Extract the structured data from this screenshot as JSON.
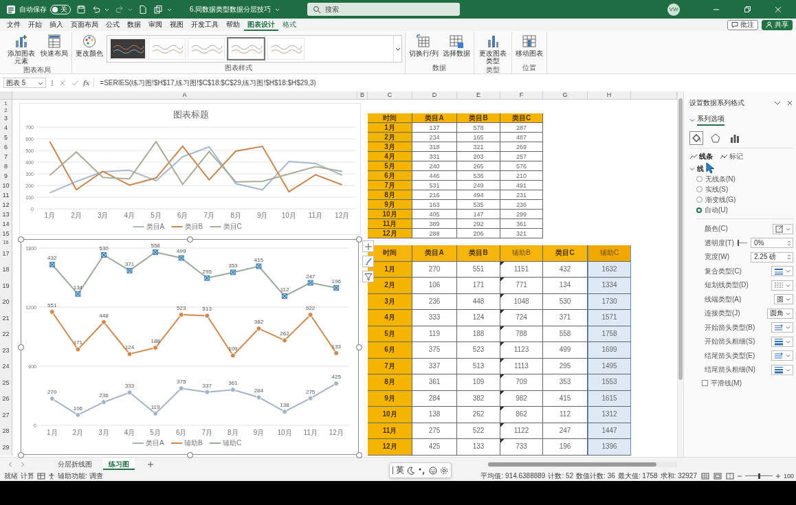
{
  "title_bar": {
    "autosave": {
      "label": "自动保存",
      "on": false,
      "state": "关"
    },
    "filename": "6.同数据类型数据分层技巧",
    "search": {
      "placeholder": "搜索"
    },
    "avatar": "VW"
  },
  "ribbon_tabs": [
    {
      "label": "文件",
      "selected": false,
      "contextual": false
    },
    {
      "label": "开始",
      "selected": false,
      "contextual": false
    },
    {
      "label": "插入",
      "selected": false,
      "contextual": false
    },
    {
      "label": "页面布局",
      "selected": false,
      "contextual": false
    },
    {
      "label": "公式",
      "selected": false,
      "contextual": false
    },
    {
      "label": "数据",
      "selected": false,
      "contextual": false
    },
    {
      "label": "审阅",
      "selected": false,
      "contextual": false
    },
    {
      "label": "视图",
      "selected": false,
      "contextual": false
    },
    {
      "label": "开发工具",
      "selected": false,
      "contextual": false
    },
    {
      "label": "帮助",
      "selected": false,
      "contextual": false
    },
    {
      "label": "图表设计",
      "selected": true,
      "contextual": true
    },
    {
      "label": "格式",
      "selected": false,
      "contextual": true
    }
  ],
  "ribbon_actions": [
    {
      "label": "批注",
      "kind": "comments"
    },
    {
      "label": "共享",
      "kind": "share"
    }
  ],
  "ribbon_groups": [
    {
      "name": "图表布局",
      "buttons": [
        {
          "label": "添加图表元素",
          "kind": "add_element"
        },
        {
          "label": "快速布局",
          "kind": "quick_layout"
        }
      ]
    },
    {
      "name": "图表样式",
      "buttons": [
        {
          "label": "更改颜色",
          "kind": "palette"
        }
      ],
      "gallery": [
        {
          "dark": true,
          "selected": false
        },
        {
          "dark": false,
          "selected": false
        },
        {
          "dark": false,
          "selected": false
        },
        {
          "dark": false,
          "selected": true
        },
        {
          "dark": false,
          "selected": false
        }
      ]
    },
    {
      "name": "数据",
      "buttons": [
        {
          "label": "切换行/列",
          "kind": "switch"
        },
        {
          "label": "选择数据",
          "kind": "select_data"
        }
      ]
    },
    {
      "name": "类型",
      "buttons": [
        {
          "label": "更改图表类型",
          "kind": "chart_type"
        }
      ]
    },
    {
      "name": "位置",
      "buttons": [
        {
          "label": "移动图表",
          "kind": "move"
        }
      ]
    }
  ],
  "formula_bar": {
    "name_box": "图表 5",
    "function_label": "fx",
    "formula": "=SERIES(练习图!$H$17,练习图!$C$18:$C$29,练习图!$H$18:$H$29,3)"
  },
  "sheet": {
    "columns": [
      "A",
      "B",
      "C",
      "D",
      "E",
      "F",
      "G",
      "H"
    ],
    "rows": [
      "1",
      "2",
      "3",
      "4",
      "5",
      "6",
      "7",
      "8",
      "9",
      "10",
      "11",
      "12",
      "13",
      "14",
      "15",
      "16",
      "17",
      "18",
      "19",
      "20",
      "21",
      "22",
      "23",
      "24",
      "25",
      "26",
      "27",
      "28",
      "29"
    ]
  },
  "charts": [
    {
      "title": "图表标题",
      "selected": false,
      "chart_data": {
        "type": "line",
        "categories": [
          "1月",
          "2月",
          "3月",
          "4月",
          "5月",
          "6月",
          "7月",
          "8月",
          "9月",
          "10月",
          "11月",
          "12月"
        ],
        "ylim": [
          0,
          700
        ],
        "yticks": [
          0,
          100,
          200,
          300,
          400,
          500,
          600,
          700
        ],
        "grid": true,
        "legend": "bottom",
        "series": [
          {
            "name": "类目A",
            "color": "#a7b8cf",
            "values": [
              137,
              234,
              318,
              331,
              240,
              446,
              531,
              216,
              163,
              405,
              389,
              288
            ]
          },
          {
            "name": "类目B",
            "color": "#c9864f",
            "values": [
              578,
              165,
              321,
              203,
              265,
              536,
              249,
              494,
              535,
              147,
              292,
              206
            ]
          },
          {
            "name": "类目C",
            "color": "#a8ad98",
            "values": [
              287,
              487,
              269,
              257,
              576,
              210,
              491,
              231,
              236,
              299,
              361,
              321
            ]
          }
        ]
      }
    },
    {
      "selected": true,
      "chart_data": {
        "type": "line",
        "categories": [
          "1月",
          "2月",
          "3月",
          "4月",
          "5月",
          "6月",
          "7月",
          "8月",
          "9月",
          "10月",
          "11月",
          "12月"
        ],
        "ylim": [
          0,
          1800
        ],
        "yticks": [
          0,
          600,
          1200,
          1800
        ],
        "grid": true,
        "legend": "bottom",
        "series": [
          {
            "name": "类目A",
            "color": "#a3b4c6",
            "marker": "circle",
            "values": [
              270,
              106,
              236,
              333,
              119,
              375,
              337,
              361,
              284,
              138,
              275,
              425
            ]
          },
          {
            "name": "辅助B",
            "color": "#d0884c",
            "marker": "circle",
            "values": [
              1151,
              771,
              1048,
              724,
              788,
              1123,
              1113,
              709,
              982,
              862,
              1122,
              733
            ]
          },
          {
            "name": "辅助C",
            "color": "#9aa99a",
            "marker": "square",
            "values": [
              1632,
              1334,
              1730,
              1571,
              1758,
              1699,
              1495,
              1553,
              1615,
              1312,
              1447,
              1396
            ]
          }
        ],
        "annotations": [
          {
            "x": "1月",
            "y": 270,
            "text": "270"
          },
          {
            "x": "2月",
            "y": 106,
            "text": "106"
          },
          {
            "x": "3月",
            "y": 236,
            "text": "236"
          },
          {
            "x": "4月",
            "y": 333,
            "text": "333"
          },
          {
            "x": "5月",
            "y": 119,
            "text": "119"
          },
          {
            "x": "6月",
            "y": 375,
            "text": "375"
          },
          {
            "x": "7月",
            "y": 337,
            "text": "337"
          },
          {
            "x": "8月",
            "y": 361,
            "text": "361"
          },
          {
            "x": "9月",
            "y": 284,
            "text": "284"
          },
          {
            "x": "10月",
            "y": 138,
            "text": "138"
          },
          {
            "x": "11月",
            "y": 275,
            "text": "275"
          },
          {
            "x": "12月",
            "y": 425,
            "text": "425"
          },
          {
            "x": "1月",
            "y": 1151,
            "text": "551"
          },
          {
            "x": "2月",
            "y": 771,
            "text": "171"
          },
          {
            "x": "3月",
            "y": 1048,
            "text": "448"
          },
          {
            "x": "4月",
            "y": 724,
            "text": "124"
          },
          {
            "x": "5月",
            "y": 788,
            "text": "188"
          },
          {
            "x": "6月",
            "y": 1123,
            "text": "523"
          },
          {
            "x": "7月",
            "y": 1113,
            "text": "513"
          },
          {
            "x": "8月",
            "y": 709,
            "text": "109"
          },
          {
            "x": "9月",
            "y": 982,
            "text": "382"
          },
          {
            "x": "10月",
            "y": 862,
            "text": "262"
          },
          {
            "x": "11月",
            "y": 1122,
            "text": "522"
          },
          {
            "x": "12月",
            "y": 733,
            "text": "133"
          },
          {
            "x": "1月",
            "y": 1632,
            "text": "432"
          },
          {
            "x": "2月",
            "y": 1334,
            "text": "134"
          },
          {
            "x": "3月",
            "y": 1730,
            "text": "530"
          },
          {
            "x": "4月",
            "y": 1571,
            "text": "371"
          },
          {
            "x": "5月",
            "y": 1758,
            "text": "558"
          },
          {
            "x": "6月",
            "y": 1699,
            "text": "499"
          },
          {
            "x": "7月",
            "y": 1495,
            "text": "295"
          },
          {
            "x": "8月",
            "y": 1553,
            "text": "353"
          },
          {
            "x": "9月",
            "y": 1615,
            "text": "415"
          },
          {
            "x": "10月",
            "y": 1312,
            "text": "112"
          },
          {
            "x": "11月",
            "y": 1447,
            "text": "247"
          },
          {
            "x": "12月",
            "y": 1396,
            "text": "196"
          }
        ]
      }
    }
  ],
  "table_1": {
    "columns": [
      {
        "label": "时间",
        "kind": "key",
        "selected": false,
        "flagged": false
      },
      {
        "label": "类目A",
        "kind": "data",
        "selected": false,
        "flagged": false
      },
      {
        "label": "类目B",
        "kind": "data",
        "selected": false,
        "flagged": false
      },
      {
        "label": "类目C",
        "kind": "data",
        "selected": false,
        "flagged": false
      }
    ],
    "rows": [
      [
        "1月",
        "137",
        "578",
        "287"
      ],
      [
        "2月",
        "234",
        "165",
        "487"
      ],
      [
        "3月",
        "318",
        "321",
        "269"
      ],
      [
        "4月",
        "331",
        "203",
        "257"
      ],
      [
        "5月",
        "240",
        "265",
        "576"
      ],
      [
        "6月",
        "446",
        "536",
        "210"
      ],
      [
        "7月",
        "531",
        "249",
        "491"
      ],
      [
        "8月",
        "216",
        "494",
        "231"
      ],
      [
        "9月",
        "163",
        "535",
        "236"
      ],
      [
        "10月",
        "405",
        "147",
        "299"
      ],
      [
        "11月",
        "389",
        "292",
        "361"
      ],
      [
        "12月",
        "288",
        "206",
        "321"
      ]
    ]
  },
  "table_2": {
    "columns": [
      {
        "label": "时间",
        "kind": "key",
        "selected": false,
        "flagged": false
      },
      {
        "label": "类目A",
        "kind": "data",
        "selected": false,
        "flagged": false
      },
      {
        "label": "类目B",
        "kind": "data",
        "selected": false,
        "flagged": false
      },
      {
        "label": "辅助B",
        "kind": "helper",
        "selected": false,
        "flagged": true
      },
      {
        "label": "类目C",
        "kind": "data",
        "selected": false,
        "flagged": false
      },
      {
        "label": "辅助C",
        "kind": "helper",
        "selected": true,
        "flagged": false
      }
    ],
    "rows": [
      [
        "1月",
        "270",
        "551",
        "1151",
        "432",
        "1632"
      ],
      [
        "2月",
        "106",
        "171",
        "771",
        "134",
        "1334"
      ],
      [
        "3月",
        "236",
        "448",
        "1048",
        "530",
        "1730"
      ],
      [
        "4月",
        "333",
        "124",
        "724",
        "371",
        "1571"
      ],
      [
        "5月",
        "119",
        "188",
        "788",
        "558",
        "1758"
      ],
      [
        "6月",
        "375",
        "523",
        "1123",
        "499",
        "1699"
      ],
      [
        "7月",
        "337",
        "513",
        "1113",
        "295",
        "1495"
      ],
      [
        "8月",
        "361",
        "109",
        "709",
        "353",
        "1553"
      ],
      [
        "9月",
        "284",
        "382",
        "982",
        "415",
        "1615"
      ],
      [
        "10月",
        "138",
        "262",
        "862",
        "112",
        "1312"
      ],
      [
        "11月",
        "275",
        "522",
        "1122",
        "247",
        "1447"
      ],
      [
        "12月",
        "425",
        "133",
        "733",
        "196",
        "1396"
      ]
    ]
  },
  "format_pane": {
    "title": "设置数据系列格式",
    "section": {
      "label": "系列选项",
      "expanded": true
    },
    "icon_tabs": [
      {
        "kind": "fill",
        "selected": true
      },
      {
        "kind": "effects",
        "selected": false
      },
      {
        "kind": "series",
        "selected": false
      }
    ],
    "sub_tabs": [
      {
        "label": "线条",
        "kind": "line",
        "selected": true
      },
      {
        "label": "标记",
        "kind": "marker",
        "selected": false
      }
    ],
    "group": {
      "label": "线",
      "expanded": true
    },
    "line_options": [
      {
        "label": "无线条(N)",
        "selected": false
      },
      {
        "label": "实线(S)",
        "selected": false
      },
      {
        "label": "渐变线(G)",
        "selected": false
      },
      {
        "label": "自动(U)",
        "selected": true
      }
    ],
    "properties": [
      {
        "label": "颜色(C)",
        "kind": "color"
      },
      {
        "label": "透明度(T)",
        "kind": "slider",
        "level": 0,
        "value": "0%"
      },
      {
        "label": "宽度(W)",
        "kind": "spin",
        "value": "2.25 磅"
      },
      {
        "label": "复合类型(C)",
        "kind": "compound"
      },
      {
        "label": "短划线类型(D)",
        "kind": "dash"
      },
      {
        "label": "线端类型(A)",
        "kind": "dropdown",
        "value": "圆"
      },
      {
        "label": "连接类型(J)",
        "kind": "dropdown",
        "value": "圆角"
      },
      {
        "label": "开始箭头类型(B)",
        "kind": "arrow_type"
      },
      {
        "label": "开始箭头粗细(S)",
        "kind": "arrow_size"
      },
      {
        "label": "结尾箭头类型(E)",
        "kind": "arrow_type"
      },
      {
        "label": "结尾箭头粗细(N)",
        "kind": "arrow_size"
      }
    ],
    "smooth": {
      "label": "平滑线(M)",
      "checked": false
    }
  },
  "sheet_tabs": [
    {
      "label": "分层折线图",
      "selected": false
    },
    {
      "label": "练习图",
      "selected": true
    }
  ],
  "ime_toolbar": {
    "mode": "英"
  },
  "status_bar": {
    "mode": "就绪",
    "calc": "计算",
    "accessibility": "辅助功能: 调查",
    "stats": [
      "平均值: 914.6388889",
      "计数: 52",
      "数值计数: 36",
      "最大值: 1758",
      "求和: 32927"
    ],
    "zoom_slider": {
      "level": 0.5
    },
    "zoom": "100"
  }
}
